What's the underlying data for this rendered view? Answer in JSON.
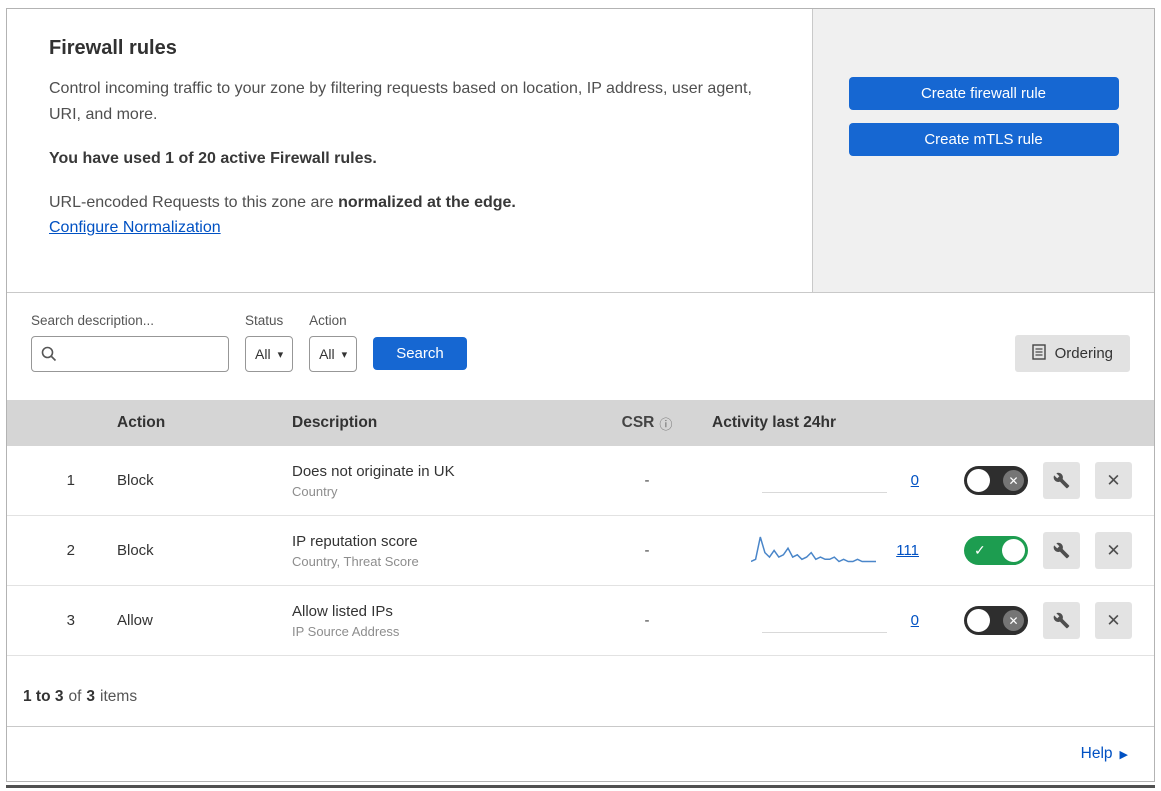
{
  "colors": {
    "accent_blue": "#1667d2",
    "link_blue": "#0051c3",
    "toggle_green": "#1d9d50",
    "toggle_off": "#2e2e2e",
    "sparkline_blue": "#4a86c9"
  },
  "icons": {
    "check": "✓",
    "cross": "✕",
    "caret": "▾",
    "info": "ⓘ",
    "help_arrow": "▶"
  },
  "intro": {
    "title": "Firewall rules",
    "description": "Control incoming traffic to your zone by filtering requests based on location, IP address, user agent, URI, and more.",
    "usage_text": "You have used 1 of 20 active Firewall rules.",
    "normalization_prefix": "URL-encoded Requests to this zone are ",
    "normalization_bold": "normalized at the edge.",
    "configure_link": "Configure Normalization"
  },
  "actions": {
    "create_firewall_rule": "Create firewall rule",
    "create_mtls_rule": "Create mTLS rule"
  },
  "filters": {
    "search_label": "Search description...",
    "status_label": "Status",
    "status_value": "All",
    "action_label": "Action",
    "action_value": "All",
    "search_button": "Search",
    "ordering_button": "Ordering"
  },
  "table": {
    "headers": {
      "action": "Action",
      "description": "Description",
      "csr": "CSR",
      "activity": "Activity last 24hr"
    },
    "rows": [
      {
        "num": "1",
        "action": "Block",
        "description": "Does not originate in UK",
        "criteria": "Country",
        "csr": "-",
        "activity": "0",
        "enabled": false,
        "sparkline": []
      },
      {
        "num": "2",
        "action": "Block",
        "description": "IP reputation score",
        "criteria": "Country, Threat Score",
        "csr": "-",
        "activity": "111",
        "enabled": true,
        "sparkline": [
          2,
          3,
          13,
          6,
          4,
          7,
          4,
          5,
          8,
          4,
          5,
          3,
          4,
          6,
          3,
          4,
          3,
          3,
          4,
          2,
          3,
          2,
          2,
          3,
          2,
          2,
          2,
          2
        ]
      },
      {
        "num": "3",
        "action": "Allow",
        "description": "Allow listed IPs",
        "criteria": "IP Source Address",
        "csr": "-",
        "activity": "0",
        "enabled": false,
        "sparkline": []
      }
    ]
  },
  "footer": {
    "range": "1 to 3",
    "of": "of",
    "total": "3",
    "items": "items"
  },
  "help": {
    "label": "Help"
  }
}
